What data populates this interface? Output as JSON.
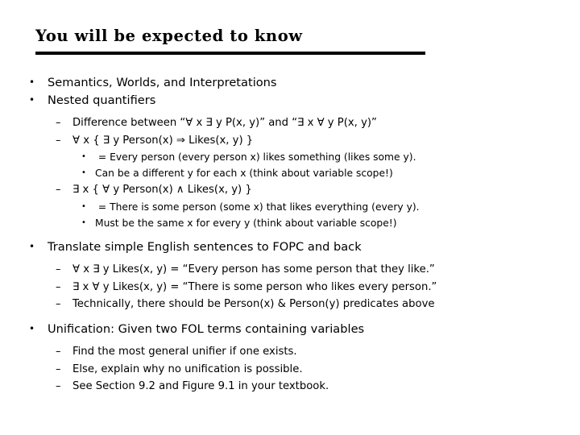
{
  "slide": {
    "title": "You will be expected to know",
    "bullet_marker": "•",
    "dash_marker": "–",
    "items": [
      {
        "level": 1,
        "text": "Semantics, Worlds, and Interpretations"
      },
      {
        "level": 1,
        "text": "Nested quantifiers"
      },
      {
        "level": 2,
        "text": "Difference between “∀ x ∃ y P(x, y)” and “∃ x ∀ y P(x, y)”"
      },
      {
        "level": 2,
        "text": "∀ x { ∃ y Person(x) ⇒ Likes(x, y) }"
      },
      {
        "level": 3,
        "text": " = Every person (every person x) likes something (likes some y)."
      },
      {
        "level": 3,
        "text": "Can be a different y for each x (think about variable scope!)"
      },
      {
        "level": 2,
        "text": "∃ x { ∀ y Person(x) ∧ Likes(x, y) }"
      },
      {
        "level": 3,
        "text": " = There is some person (some x) that likes everything (every y)."
      },
      {
        "level": 3,
        "text": "Must be the same x for every y (think about variable scope!)"
      },
      {
        "level": 1,
        "text": "Translate simple English sentences to FOPC and back"
      },
      {
        "level": 2,
        "text": "∀ x ∃ y Likes(x, y) = “Every person has some person that they like.”"
      },
      {
        "level": 2,
        "text": "∃ x ∀ y Likes(x, y) = “There is some person who likes every person.”"
      },
      {
        "level": 2,
        "text": "Technically, there should be Person(x) & Person(y) predicates above"
      },
      {
        "level": 1,
        "text": "Unification: Given two FOL terms containing variables"
      },
      {
        "level": 2,
        "text": "Find the most general unifier if one exists."
      },
      {
        "level": 2,
        "text": "Else, explain why no unification is possible."
      },
      {
        "level": 2,
        "text": "See Section 9.2 and Figure 9.1 in your textbook."
      }
    ]
  }
}
